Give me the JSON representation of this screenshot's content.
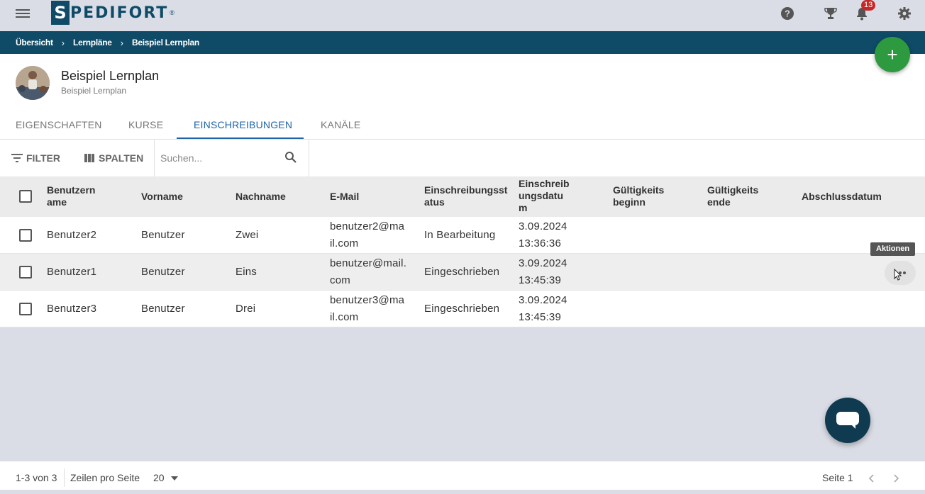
{
  "brand": {
    "name": "PEDIFORT",
    "letter": "S",
    "reg": "®"
  },
  "top_icons": {
    "help": "help-circle-icon",
    "trophy": "trophy-icon",
    "bell": "bell-icon",
    "settings": "gear-icon"
  },
  "notifications": {
    "count": "13"
  },
  "breadcrumb": [
    "Übersicht",
    "Lernpläne",
    "Beispiel Lernplan"
  ],
  "header": {
    "title": "Beispiel Lernplan",
    "subtitle": "Beispiel Lernplan"
  },
  "tabs": [
    {
      "label": "EIGENSCHAFTEN"
    },
    {
      "label": "KURSE"
    },
    {
      "label": "EINSCHREIBUNGEN",
      "active": true
    },
    {
      "label": "KANÄLE"
    }
  ],
  "toolbar": {
    "filter": "FILTER",
    "columns": "SPALTEN",
    "search_placeholder": "Suchen..."
  },
  "columns": [
    "Benutzern ame",
    "Vorname",
    "Nachname",
    "E-Mail",
    "Einschreibungsst atus",
    "Einschreib ungsdatu m",
    "Gültigkeits beginn",
    "Gültigkeits ende",
    "Abschlussdatum"
  ],
  "columns_display": {
    "c0": [
      "Benutzern",
      "ame"
    ],
    "c4": [
      "Einschreibungsst",
      "atus"
    ],
    "c5": [
      "Einschreib",
      "ungsdatu",
      "m"
    ],
    "c6": [
      "Gültigkeits",
      "beginn"
    ],
    "c7": [
      "Gültigkeits",
      "ende"
    ]
  },
  "rows": [
    {
      "username": "Benutzer2",
      "firstname": "Benutzer",
      "lastname": "Zwei",
      "email1": "benutzer2@ma",
      "email2": "il.com",
      "status": "In Bearbeitung",
      "date1": "3.09.2024",
      "date2": "13:36:36"
    },
    {
      "username": "Benutzer1",
      "firstname": "Benutzer",
      "lastname": "Eins",
      "email1": "benutzer@mail.",
      "email2": "com",
      "status": "Eingeschrieben",
      "date1": "3.09.2024",
      "date2": "13:45:39"
    },
    {
      "username": "Benutzer3",
      "firstname": "Benutzer",
      "lastname": "Drei",
      "email1": "benutzer3@ma",
      "email2": "il.com",
      "status": "Eingeschrieben",
      "date1": "3.09.2024",
      "date2": "13:45:39"
    }
  ],
  "tooltip": "Aktionen",
  "footer": {
    "range": "1-3 von 3",
    "rows_per_page_label": "Zeilen pro Seite",
    "rows_per_page": "20",
    "page": "Seite 1"
  },
  "colors": {
    "brand": "#0f4b67",
    "accent": "#1e63a8",
    "fab": "#2e9a3f",
    "badge": "#c62828"
  }
}
